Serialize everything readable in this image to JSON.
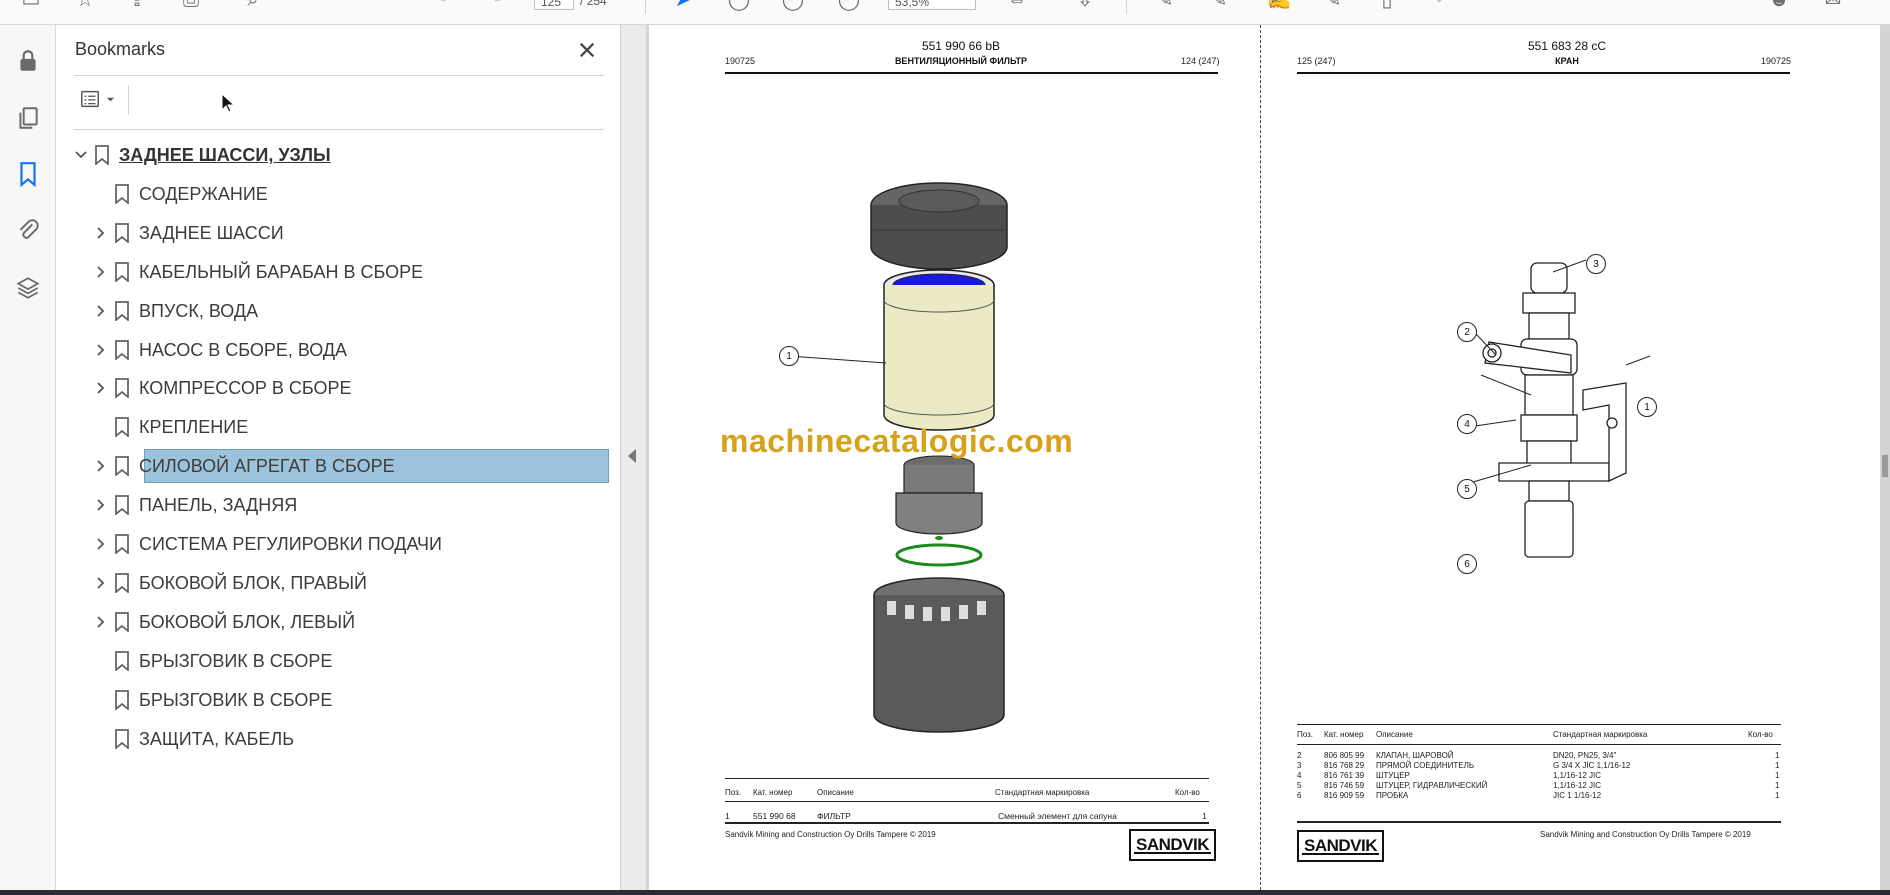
{
  "toolbar": {
    "page_current": "125",
    "page_separator": "/",
    "page_total": "254",
    "zoom": "53,5%"
  },
  "bookmarks": {
    "title": "Bookmarks",
    "close_icon": "close-icon",
    "items": [
      {
        "label": "ЗАДНЕЕ ШАССИ, УЗЛЫ",
        "level": 0,
        "expanded": true,
        "has_children": true
      },
      {
        "label": "СОДЕРЖАНИЕ",
        "level": 1,
        "has_children": false
      },
      {
        "label": "ЗАДНЕЕ ШАССИ",
        "level": 1,
        "has_children": true
      },
      {
        "label": "КАБЕЛЬНЫЙ БАРАБАН В СБОРЕ",
        "level": 1,
        "has_children": true
      },
      {
        "label": "ВПУСК, ВОДА",
        "level": 1,
        "has_children": true
      },
      {
        "label": "НАСОС В СБОРЕ, ВОДА",
        "level": 1,
        "has_children": true
      },
      {
        "label": "КОМПРЕССОР В СБОРЕ",
        "level": 1,
        "has_children": true
      },
      {
        "label": "КРЕПЛЕНИЕ",
        "level": 1,
        "has_children": false
      },
      {
        "label": "СИЛОВОЙ АГРЕГАТ В СБОРЕ",
        "level": 1,
        "has_children": true,
        "selected": true
      },
      {
        "label": "ПАНЕЛЬ, ЗАДНЯЯ",
        "level": 1,
        "has_children": true
      },
      {
        "label": "СИСТЕМА РЕГУЛИРОВКИ ПОДАЧИ",
        "level": 1,
        "has_children": true
      },
      {
        "label": "БОКОВОЙ БЛОК, ПРАВЫЙ",
        "level": 1,
        "has_children": true
      },
      {
        "label": "БОКОВОЙ БЛОК, ЛЕВЫЙ",
        "level": 1,
        "has_children": true
      },
      {
        "label": "БРЫЗГОВИК В СБОРЕ",
        "level": 1,
        "has_children": false
      },
      {
        "label": "БРЫЗГОВИК В СБОРЕ",
        "level": 1,
        "has_children": false
      },
      {
        "label": "ЗАЩИТА, КАБЕЛЬ",
        "level": 1,
        "has_children": false
      }
    ]
  },
  "pages": {
    "left": {
      "code": "551 990 66 bB",
      "date": "190725",
      "title": "ВЕНТИЛЯЦИОННЫЙ ФИЛЬТР",
      "page_ref": "124 (247)",
      "table_headers": [
        "Поз.",
        "Кат. номер",
        "Описание",
        "Стандартная маркировка",
        "Кол-во"
      ],
      "rows": [
        {
          "pos": "1",
          "part": "551 990 68",
          "desc": "ФИЛЬТР",
          "std": "Сменный элемент для сапуна",
          "qty": "1"
        }
      ],
      "callouts": [
        "1"
      ],
      "copyright": "Sandvik Mining and Construction Oy Drills Tampere © 2019",
      "logo": "SANDVIK"
    },
    "right": {
      "code": "551 683 28 cC",
      "page_ref": "125 (247)",
      "title": "КРАН",
      "date": "190725",
      "table_headers": [
        "Поз.",
        "Кат. номер",
        "Описание",
        "Стандартная маркировка",
        "Кол-во"
      ],
      "rows": [
        {
          "pos": "2",
          "part": "806 805 99",
          "desc": "КЛАПАН, ШАРОВОЙ",
          "std": "DN20, PN25, 3/4\"",
          "qty": "1"
        },
        {
          "pos": "3",
          "part": "816 768 29",
          "desc": "ПРЯМОЙ СОЕДИНИТЕЛЬ",
          "std": "G 3/4 X JIC 1,1/16-12",
          "qty": "1"
        },
        {
          "pos": "4",
          "part": "816 761 39",
          "desc": "ШТУЦЕР",
          "std": "1,1/16-12 JIC",
          "qty": "1"
        },
        {
          "pos": "5",
          "part": "816 746 59",
          "desc": "ШТУЦЕР, ГИДРАВЛИЧЕСКИЙ",
          "std": "1,1/16-12 JIC",
          "qty": "1"
        },
        {
          "pos": "6",
          "part": "816 909 59",
          "desc": "ПРОБКА",
          "std": "JIC 1 1/16-12",
          "qty": "1"
        }
      ],
      "callouts": [
        "3",
        "2",
        "1",
        "4",
        "5",
        "6"
      ],
      "copyright": "Sandvik Mining and Construction Oy Drills Tampere © 2019",
      "logo": "SANDVIK"
    }
  },
  "watermark": "machinecatalogic.com",
  "colors": {
    "selection": "#9dc3dc",
    "rail_active": "#1473e6",
    "watermark": "#d6a21b"
  }
}
